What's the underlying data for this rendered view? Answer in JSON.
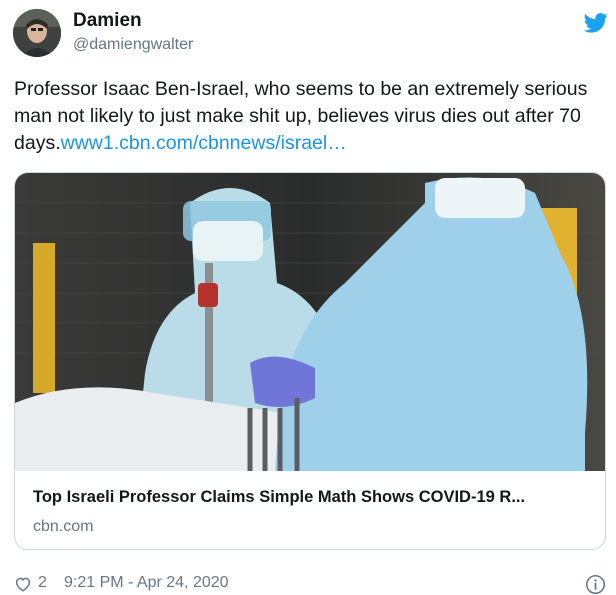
{
  "author": {
    "name": "Damien",
    "handle": "@damiengwalter"
  },
  "tweet": {
    "text": "Professor Isaac Ben-Israel, who seems to be an extremely serious man not likely to just make shit up, believes virus dies out after 70 days.",
    "link_text": "www1.cbn.com/cbnnews/israel…"
  },
  "card": {
    "title": "Top Israeli Professor Claims Simple Math Shows COVID-19 R...",
    "domain": "cbn.com"
  },
  "footer": {
    "like_count": "2",
    "timestamp": "9:21 PM - Apr 24, 2020"
  },
  "colors": {
    "link": "#1b95e0",
    "twitter_blue": "#1da1f2",
    "secondary_text": "#657786",
    "border": "#ccd6dd"
  },
  "icons": {
    "brand": "twitter-bird-icon",
    "like": "heart-icon",
    "info": "info-icon"
  }
}
